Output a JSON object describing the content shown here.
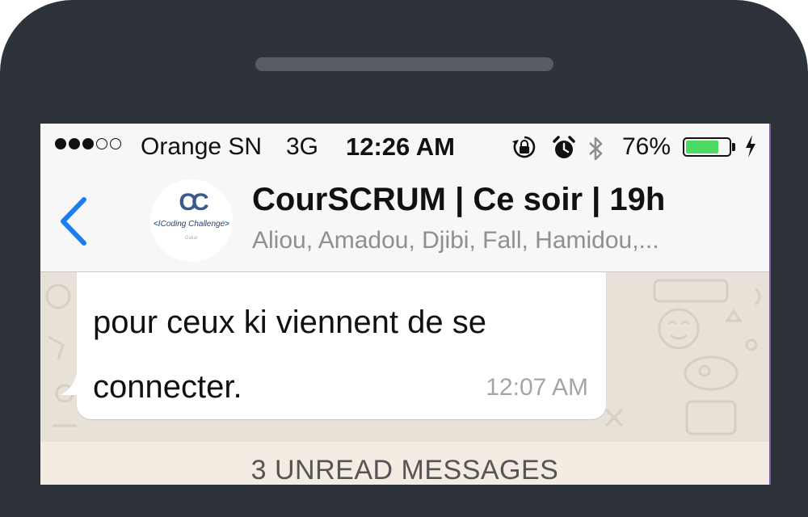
{
  "status_bar": {
    "carrier": "Orange SN",
    "network": "3G",
    "time": "12:26 AM",
    "battery_percent": "76%",
    "battery_level": 0.76,
    "signal_bars_filled": 3,
    "signal_bars_total": 5,
    "icons": [
      "orientation-lock-icon",
      "alarm-icon",
      "bluetooth-icon",
      "battery-icon",
      "charging-bolt-icon"
    ]
  },
  "header": {
    "back_icon": "chevron-left-icon",
    "group_name": "CourSCRUM | Ce soir | 19h",
    "members": "Aliou, Amadou, Djibi, Fall, Hamidou,...",
    "avatar": {
      "monogram": "CC",
      "caption_open": "</",
      "caption_text": "Coding Challenge",
      "caption_close": ">",
      "subtext": "Dakar"
    }
  },
  "messages": [
    {
      "text": "pour ceux ki viennent de se connecter.",
      "time": "12:07 AM"
    }
  ],
  "unread_banner": "3 UNREAD MESSAGES",
  "colors": {
    "frame": "#2d323b",
    "accent": "#1a7ef2",
    "battery": "#4cd964",
    "chat_bg": "#e7e1d8",
    "bubble": "#ffffff"
  }
}
